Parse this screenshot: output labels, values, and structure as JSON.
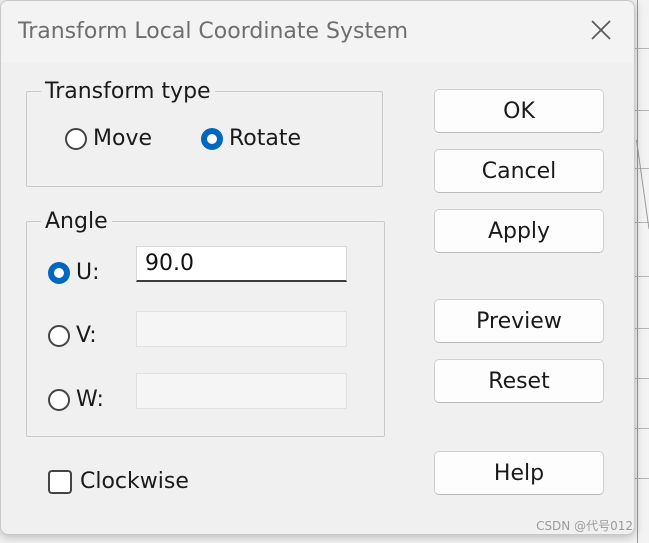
{
  "dialog": {
    "title": "Transform Local Coordinate System",
    "close_icon": "close-icon"
  },
  "transform_type": {
    "legend": "Transform type",
    "options": [
      {
        "label": "Move",
        "checked": false
      },
      {
        "label": "Rotate",
        "checked": true
      }
    ]
  },
  "angle": {
    "legend": "Angle",
    "axes": [
      {
        "label": "U:",
        "checked": true,
        "value": "90.0",
        "enabled": true
      },
      {
        "label": "V:",
        "checked": false,
        "value": "",
        "enabled": false
      },
      {
        "label": "W:",
        "checked": false,
        "value": "",
        "enabled": false
      }
    ]
  },
  "clockwise": {
    "label": "Clockwise",
    "checked": false
  },
  "buttons": {
    "ok": "OK",
    "cancel": "Cancel",
    "apply": "Apply",
    "preview": "Preview",
    "reset": "Reset",
    "help": "Help"
  },
  "colors": {
    "accent": "#0067c0",
    "dialog_bg": "#f0f0f0"
  },
  "watermark": "CSDN @代号012"
}
